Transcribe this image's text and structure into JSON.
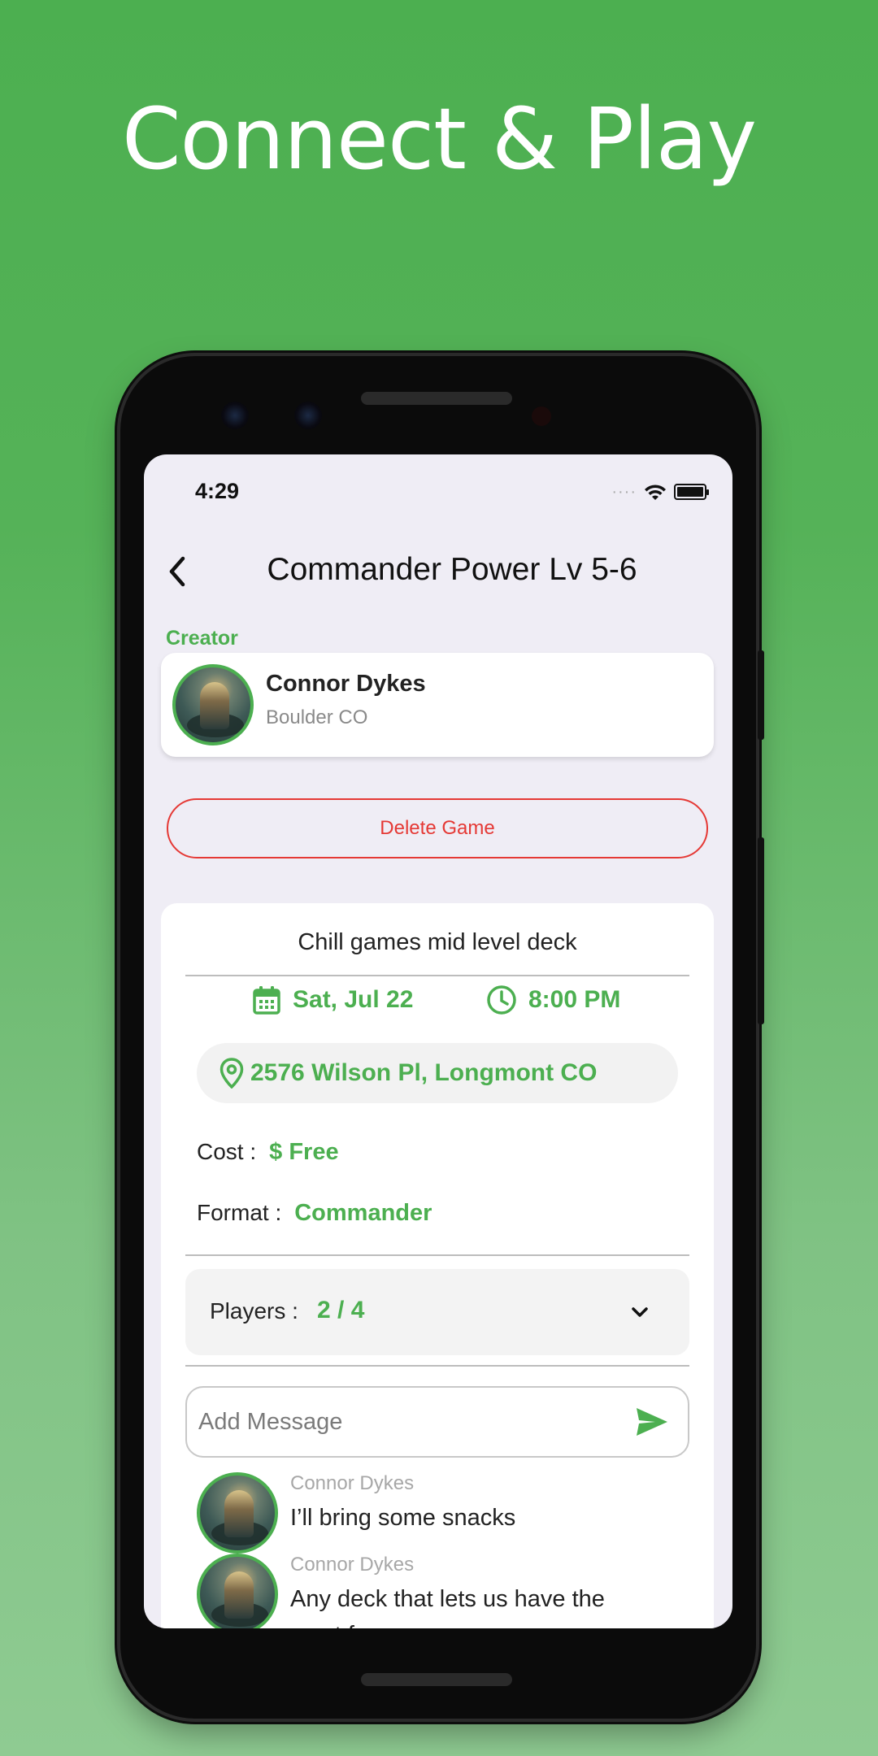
{
  "promo": {
    "headline": "Connect & Play"
  },
  "status_bar": {
    "time": "4:29"
  },
  "header": {
    "title": "Commander Power Lv 5-6"
  },
  "creator": {
    "section_label": "Creator",
    "name": "Connor Dykes",
    "location": "Boulder CO"
  },
  "actions": {
    "delete_label": "Delete Game"
  },
  "game": {
    "description": "Chill games mid level deck",
    "date": "Sat, Jul 22",
    "time": "8:00 PM",
    "address": "2576 Wilson Pl, Longmont CO",
    "cost_label": "Cost :",
    "cost_value": "$ Free",
    "format_label": "Format :",
    "format_value": "Commander",
    "players_label": "Players :",
    "players_value": "2 / 4"
  },
  "message_input": {
    "placeholder": "Add Message"
  },
  "messages": [
    {
      "author": "Connor Dykes",
      "text": "I’ll bring some snacks"
    },
    {
      "author": "Connor Dykes",
      "text": "Any deck that lets us have the most fun."
    }
  ],
  "colors": {
    "accent": "#4caf50",
    "danger": "#e53935",
    "background": "#efedf5"
  }
}
